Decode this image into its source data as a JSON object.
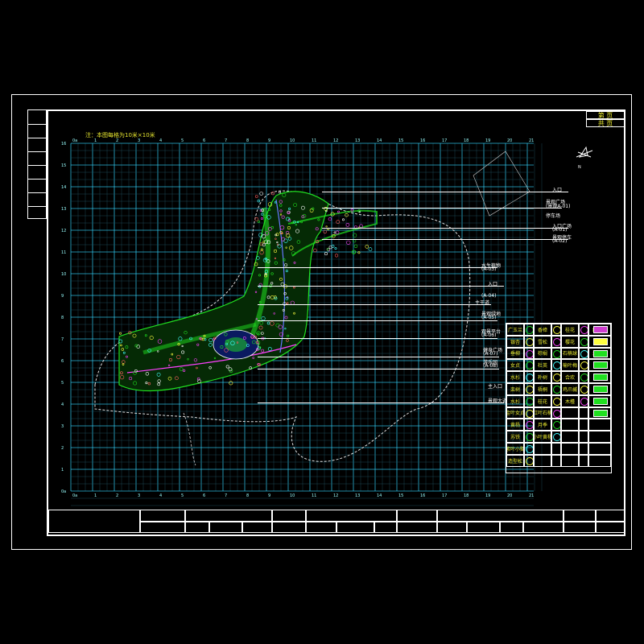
{
  "note": "注：本图每格为10米×10米",
  "north_label": "N",
  "sheet_box": {
    "page_label": "第  页",
    "total_label": "共  页"
  },
  "title_block": {
    "row1": [
      "建设单位",
      "",
      "工程名称",
      "",
      "图 名",
      "总图总平面图",
      "设计号",
      ""
    ],
    "row2": [
      "设 计",
      "",
      "校 核",
      "",
      "审 核",
      "",
      "审 定",
      "",
      "项 总",
      "",
      "日 期",
      "",
      "图纸编号",
      "",
      "顺序号"
    ]
  },
  "zone_labels": [
    "入口",
    "景观广场",
    "(景观A-01)",
    "停车场",
    "入口广场",
    "(A-01)",
    "景观停车",
    "(A-02)",
    "水生植物",
    "(A-03)",
    "入口",
    "(A-04)",
    "主干道",
    "景观绿地",
    "(A-05)",
    "观景平台",
    "(A-06)",
    "健身广场",
    "(A-07)",
    "游乐园",
    "(A-08)",
    "主入口",
    "景观大道"
  ],
  "legend": {
    "rows": [
      [
        "广玉兰",
        "香樟",
        "桂花",
        "红叶李"
      ],
      [
        "银杏",
        "雪松",
        "樱花",
        "紫薇"
      ],
      [
        "垂柳",
        "棕榈",
        "石楠球",
        "海桐球"
      ],
      [
        "女贞",
        "杜英",
        "榆叶梅",
        "红枫"
      ],
      [
        "水杉",
        "朴树",
        "合欢",
        "草坪"
      ],
      [
        "栾树",
        "梧桐",
        "鸡爪槭",
        "竹林"
      ],
      [
        "水杉",
        "桂花",
        "木槿",
        "地被"
      ],
      [
        "金叶女贞",
        "红叶石楠",
        "",
        ""
      ],
      [
        "黄杨",
        "月季",
        "",
        ""
      ],
      [
        "苏铁",
        "小叶黄杨",
        "",
        ""
      ],
      [
        "紫叶小檗",
        "",
        "",
        ""
      ],
      [
        "造型松",
        "",
        "",
        ""
      ]
    ]
  },
  "grid_axis": {
    "top": [
      "0a",
      "1",
      "2",
      "3",
      "4",
      "5",
      "6",
      "7",
      "8",
      "9",
      "10",
      "11",
      "12",
      "13",
      "14",
      "15",
      "16",
      "17",
      "18",
      "19",
      "20",
      "21"
    ],
    "left": [
      "16",
      "15",
      "14",
      "13",
      "12",
      "11",
      "10",
      "9",
      "8",
      "7",
      "6",
      "5",
      "4",
      "3",
      "2",
      "1",
      "0a"
    ]
  },
  "colors": {
    "grid": "#33d6ff",
    "frame": "#ffffff",
    "text": "#e8e830",
    "plan": "#20e020",
    "path": "#ff40ff"
  }
}
